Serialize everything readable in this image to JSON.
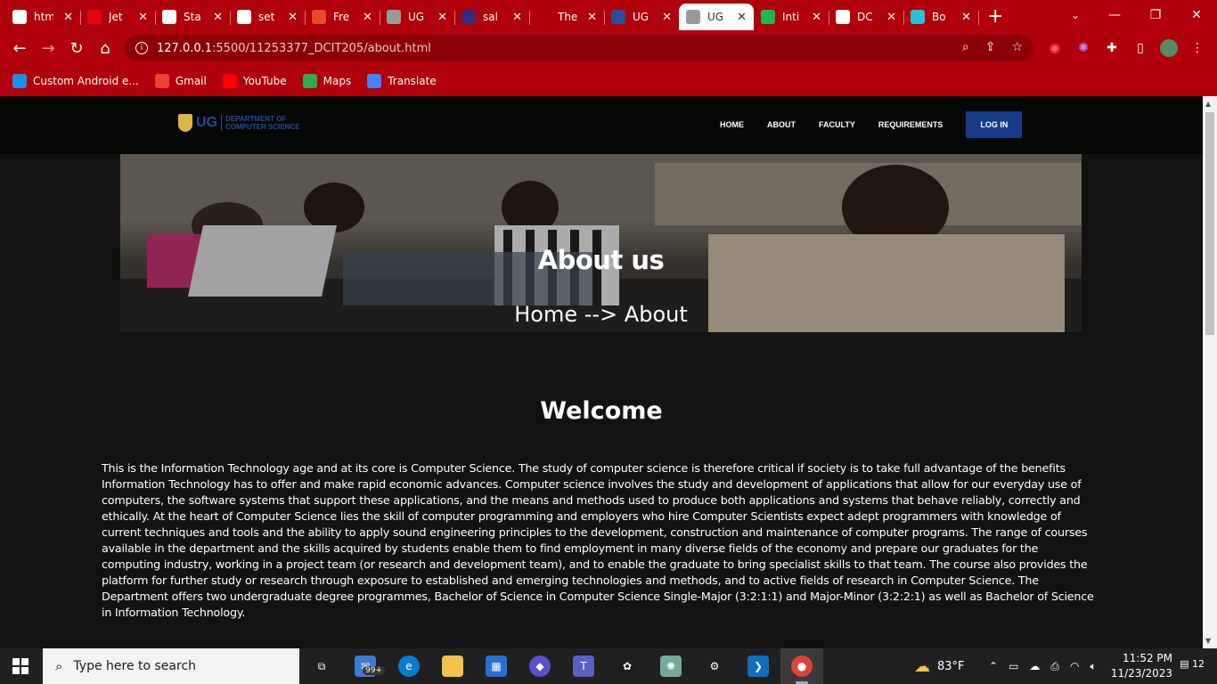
{
  "browser": {
    "tabs": [
      {
        "title": "htm",
        "favicon": "google-icon",
        "color": "#ffffff"
      },
      {
        "title": "Jet",
        "favicon": "swiss-flag-icon",
        "color": "#e30613"
      },
      {
        "title": "Sta",
        "favicon": "github-icon",
        "color": "#ffffff"
      },
      {
        "title": "set",
        "favicon": "google-icon",
        "color": "#ffffff"
      },
      {
        "title": "Fre",
        "favicon": "html5-icon",
        "color": "#e44d26"
      },
      {
        "title": "UG",
        "favicon": "globe-icon",
        "color": "#9a9a9a"
      },
      {
        "title": "sal",
        "favicon": "crest-icon",
        "color": "#3b2a7a"
      },
      {
        "title": "The",
        "favicon": "blank-icon",
        "color": "#b0000b"
      },
      {
        "title": "UG",
        "favicon": "ug-icon",
        "color": "#2a4e9c"
      },
      {
        "title": "UG",
        "favicon": "globe-icon",
        "color": "#9a9a9a"
      },
      {
        "title": "Inti",
        "favicon": "play-icon",
        "color": "#1db954"
      },
      {
        "title": "DC",
        "favicon": "github-icon",
        "color": "#ffffff"
      },
      {
        "title": "Bo",
        "favicon": "cube-icon",
        "color": "#23c4d9"
      }
    ],
    "url_host": "127.0.0.1",
    "url_path": ":5500/11253377_DCIT205/about.html",
    "bookmarks": [
      {
        "label": "Custom Android e...",
        "icon": "nox-icon",
        "color": "#1f8fe6"
      },
      {
        "label": "Gmail",
        "icon": "gmail-icon",
        "color": "#ea4335"
      },
      {
        "label": "YouTube",
        "icon": "youtube-icon",
        "color": "#ff0000"
      },
      {
        "label": "Maps",
        "icon": "maps-icon",
        "color": "#34a853"
      },
      {
        "label": "Translate",
        "icon": "translate-icon",
        "color": "#4285f4"
      }
    ],
    "accent": "#b0000b"
  },
  "site": {
    "logo_ug": "UG",
    "logo_dept_1": "DEPARTMENT OF",
    "logo_dept_2": "COMPUTER SCIENCE",
    "nav": [
      "HOME",
      "ABOUT",
      "FACULTY",
      "REQUIREMENTS"
    ],
    "login": "LOG IN",
    "hero_title": "About us",
    "hero_breadcrumb": "Home --> About",
    "welcome": "Welcome",
    "about_text": "This is the Information Technology age and at its core is Computer Science. The study of computer science is therefore critical if society is to take full advantage of the benefits Information Technology has to offer and make rapid economic advances. Computer science involves the study and development of applications that allow for our everyday use of computers, the software systems that support these applications, and the means and methods used to produce both applications and systems that behave reliably, correctly and ethically. At the heart of Computer Science lies the skill of computer programming and employers who hire Computer Scientists expect adept programmers with knowledge of current techniques and tools and the ability to apply sound engineering principles to the development, construction and maintenance of computer programs. The range of courses available in the department and the skills acquired by students enable them to find employment in many diverse fields of the economy and prepare our graduates for the computing industry, working in a project team (or research and development team), and to enable the graduate to bring specialist skills to that team. The course also provides the platform for further study or research through exposure to established and emerging technologies and methods, and to active fields of research in Computer Science. The Department offers two undergraduate degree programmes, Bachelor of Science in Computer Science Single-Major (3:2:1:1) and Major-Minor (3:2:2:1) as well as Bachelor of Science in Information Technology."
  },
  "taskbar": {
    "search_placeholder": "Type here to search",
    "mail_badge": "99+",
    "weather": "83°F",
    "time": "11:52 PM",
    "date": "11/23/2023",
    "notifications": "12"
  }
}
